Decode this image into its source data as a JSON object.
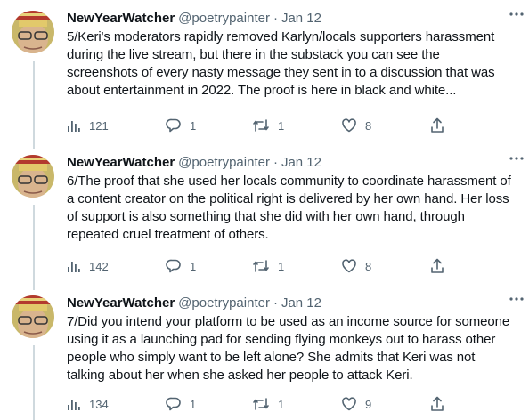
{
  "tweets": [
    {
      "name": "NewYearWatcher",
      "handle": "@poetrypainter",
      "dot": "·",
      "date": "Jan 12",
      "text": "5/Keri's moderators rapidly removed Karlyn/locals supporters harassment during the live stream, but there in the substack you can see the screenshots of every nasty message they sent in to a discussion that was about entertainment in 2022.  The proof is here in black and white...",
      "views": "121",
      "replies": "1",
      "retweets": "1",
      "likes": "8"
    },
    {
      "name": "NewYearWatcher",
      "handle": "@poetrypainter",
      "dot": "·",
      "date": "Jan 12",
      "text": "6/The proof that she used her locals community to coordinate harassment of a content creator on the political right is delivered by her own hand.  Her loss of support is also something that she did with her own hand, through repeated cruel treatment of others.",
      "views": "142",
      "replies": "1",
      "retweets": "1",
      "likes": "8"
    },
    {
      "name": "NewYearWatcher",
      "handle": "@poetrypainter",
      "dot": "·",
      "date": "Jan 12",
      "text": "7/Did you intend your platform to be used as an income source for someone using it as a launching pad for sending flying monkeys out to harass other people who simply want to be left alone?  She admits that Keri was not talking about her when she asked her people to attack Keri.",
      "views": "134",
      "replies": "1",
      "retweets": "1",
      "likes": "9"
    }
  ],
  "icons": {
    "views": "analytics-icon",
    "reply": "reply-icon",
    "retweet": "retweet-icon",
    "like": "heart-icon",
    "share": "share-icon",
    "more": "more-icon"
  },
  "colors": {
    "text": "#0f1419",
    "secondary": "#536471",
    "thread_line": "#cfd9de"
  }
}
